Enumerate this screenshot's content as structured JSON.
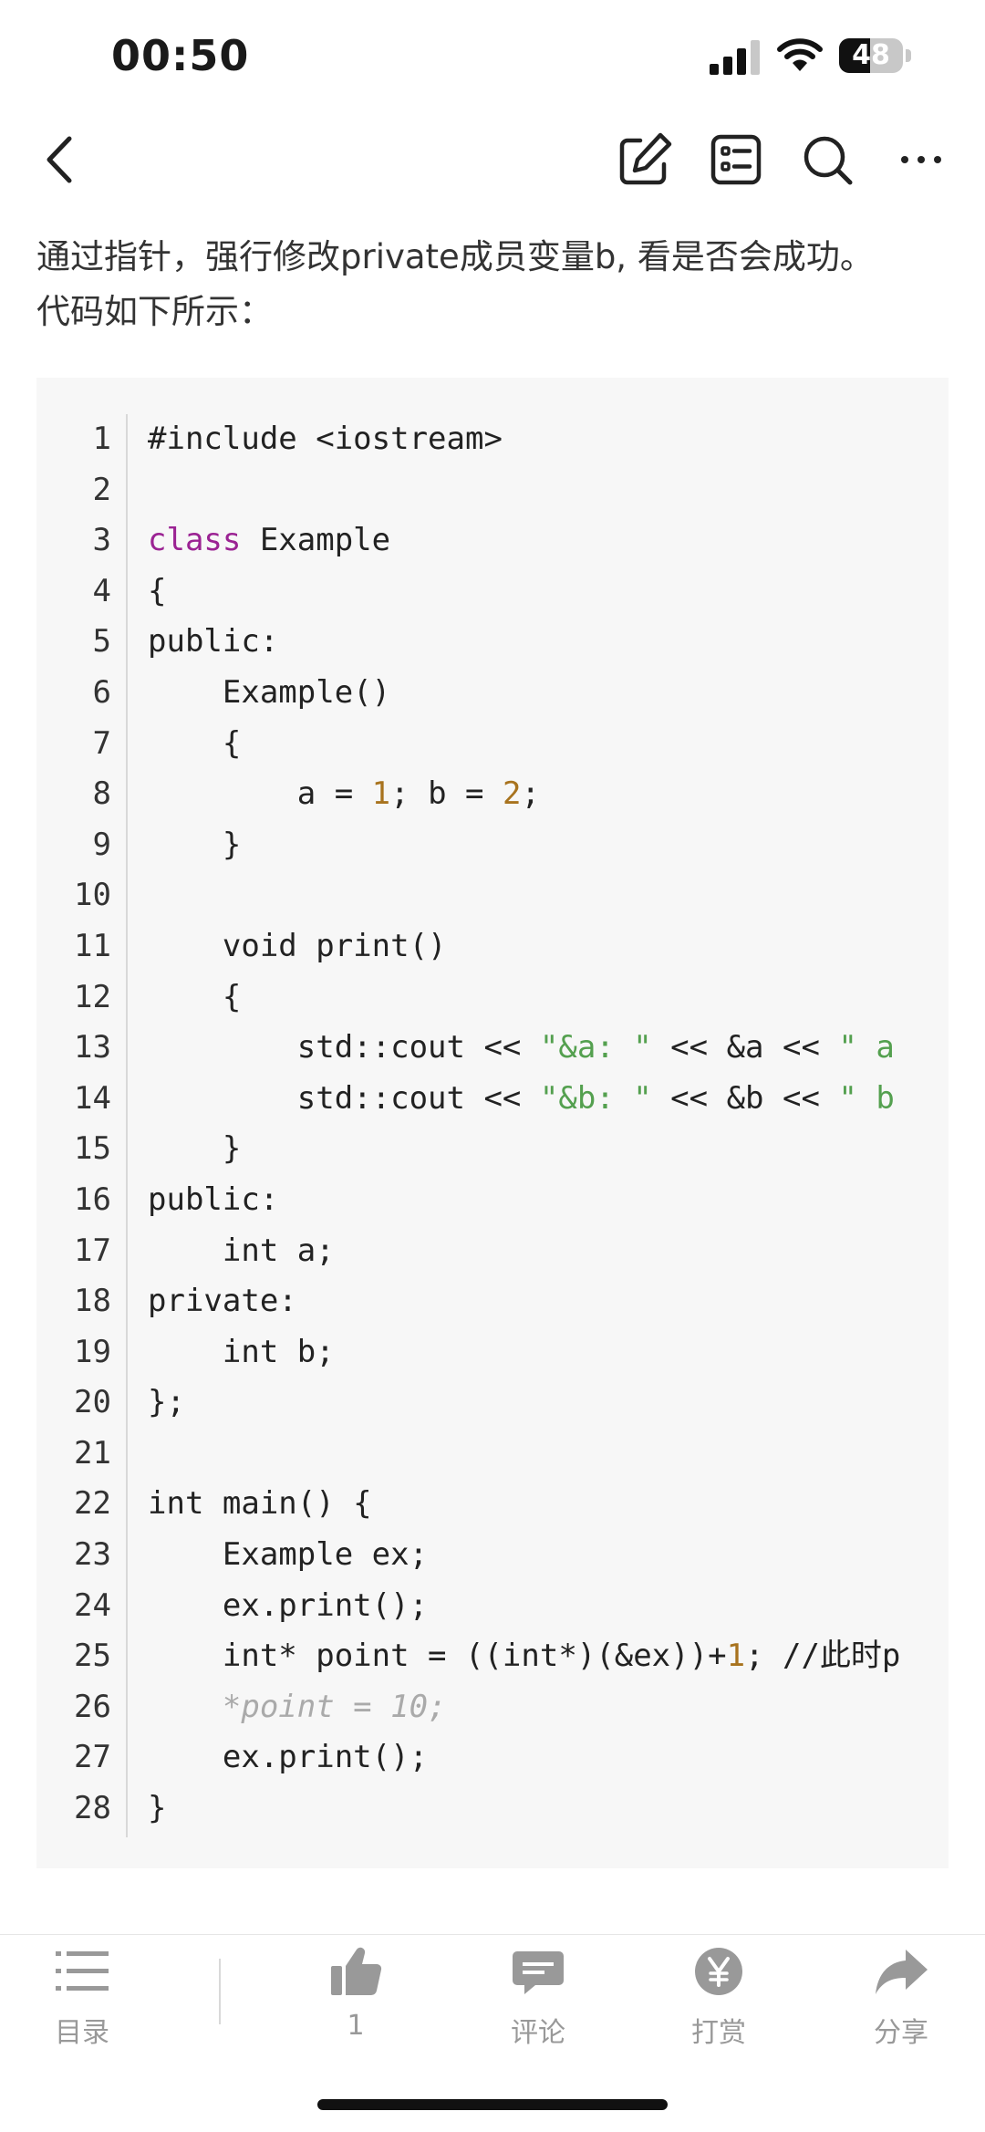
{
  "status_bar": {
    "time": "00:50",
    "battery_percent": "48",
    "battery_level": 0.48
  },
  "nav": {
    "icons": [
      "chevron-left-icon",
      "edit-icon",
      "outline-icon",
      "search-icon",
      "more-icon"
    ]
  },
  "article": {
    "intro_line1": "通过指针，强行修改private成员变量b, 看是否会成功。",
    "intro_line2": "代码如下所示："
  },
  "code": {
    "lines": [
      {
        "n": "1",
        "text": "#include <iostream>"
      },
      {
        "n": "2",
        "text": ""
      },
      {
        "n": "3",
        "text": "class Example"
      },
      {
        "n": "4",
        "text": "{"
      },
      {
        "n": "5",
        "text": "public:"
      },
      {
        "n": "6",
        "text": "    Example()"
      },
      {
        "n": "7",
        "text": "    {"
      },
      {
        "n": "8",
        "text": "        a = 1; b = 2;"
      },
      {
        "n": "9",
        "text": "    }"
      },
      {
        "n": "10",
        "text": ""
      },
      {
        "n": "11",
        "text": "    void print()"
      },
      {
        "n": "12",
        "text": "    {"
      },
      {
        "n": "13",
        "text": "        std::cout << \"&a: \" << &a << \" a"
      },
      {
        "n": "14",
        "text": "        std::cout << \"&b: \" << &b << \" b"
      },
      {
        "n": "15",
        "text": "    }"
      },
      {
        "n": "16",
        "text": "public:"
      },
      {
        "n": "17",
        "text": "    int a;"
      },
      {
        "n": "18",
        "text": "private:"
      },
      {
        "n": "19",
        "text": "    int b;"
      },
      {
        "n": "20",
        "text": "};"
      },
      {
        "n": "21",
        "text": ""
      },
      {
        "n": "22",
        "text": "int main() {"
      },
      {
        "n": "23",
        "text": "    Example ex;"
      },
      {
        "n": "24",
        "text": "    ex.print();"
      },
      {
        "n": "25",
        "text": "    int* point = ((int*)(&ex))+1; //此时p"
      },
      {
        "n": "26",
        "text": "    *point = 10;"
      },
      {
        "n": "27",
        "text": "    ex.print();"
      },
      {
        "n": "28",
        "text": "}"
      }
    ]
  },
  "bottom_bar": {
    "contents_label": "目录",
    "like_count": "1",
    "comment_label": "评论",
    "reward_label": "打赏",
    "share_label": "分享"
  },
  "colors": {
    "keyword": "#9b2393",
    "number": "#a8731e",
    "string": "#54a04f",
    "comment": "#aaaaaa",
    "code_background": "#f7f7f7",
    "toolbar_icon": "#999999"
  }
}
